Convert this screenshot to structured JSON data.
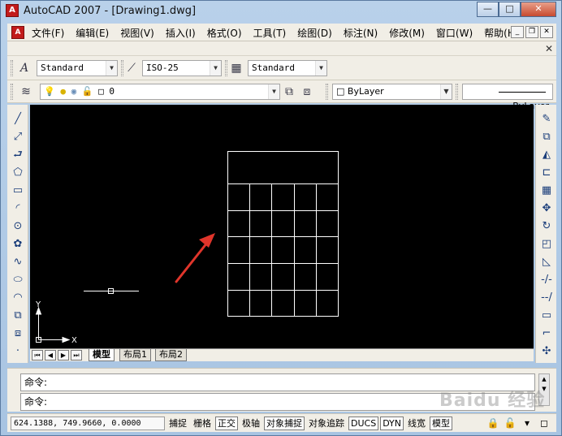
{
  "window": {
    "title": "AutoCAD 2007 - [Drawing1.dwg]",
    "app_icon": "A",
    "minimize": "—",
    "maximize": "□",
    "close": "✕"
  },
  "menu": {
    "items": [
      "文件(F)",
      "编辑(E)",
      "视图(V)",
      "插入(I)",
      "格式(O)",
      "工具(T)",
      "绘图(D)",
      "标注(N)",
      "修改(M)",
      "窗口(W)",
      "帮助(H)"
    ]
  },
  "styles_toolbar": {
    "text_style": "Standard",
    "dim_style": "ISO-25",
    "table_style": "Standard"
  },
  "layers_toolbar": {
    "current_layer": "0",
    "color": "ByLayer",
    "linetype": "ByLayer"
  },
  "canvas": {
    "background": "#000000",
    "ucs_y": "Y",
    "ucs_x": "X",
    "arrow_color": "#e0352b"
  },
  "layout_tabs": {
    "tabs": [
      "模型",
      "布局1",
      "布局2"
    ],
    "active": "模型"
  },
  "command": {
    "line1": "命令:",
    "line2": "命令:"
  },
  "status": {
    "coords": "624.1388, 749.9660, 0.0000",
    "toggles": [
      {
        "label": "捕捉",
        "on": false
      },
      {
        "label": "栅格",
        "on": false
      },
      {
        "label": "正交",
        "on": true
      },
      {
        "label": "极轴",
        "on": false
      },
      {
        "label": "对象捕捉",
        "on": true
      },
      {
        "label": "对象追踪",
        "on": false
      },
      {
        "label": "DUCS",
        "on": true
      },
      {
        "label": "DYN",
        "on": true
      },
      {
        "label": "线宽",
        "on": false
      },
      {
        "label": "模型",
        "on": true
      }
    ]
  },
  "watermark": "Baidu 经验"
}
